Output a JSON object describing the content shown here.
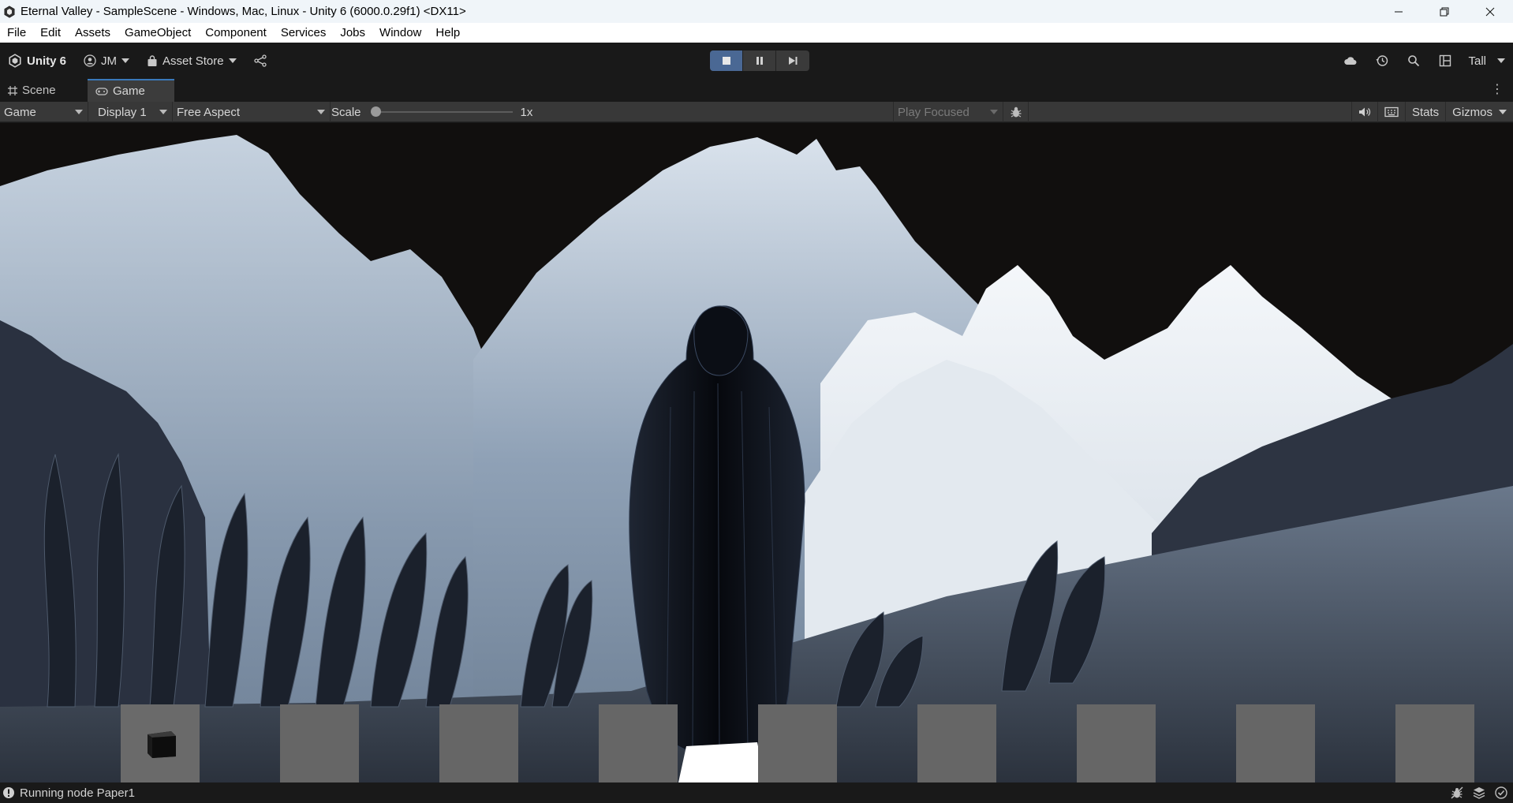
{
  "window": {
    "title": "Eternal Valley - SampleScene - Windows, Mac, Linux - Unity 6 (6000.0.29f1) <DX11>"
  },
  "menu": [
    "File",
    "Edit",
    "Assets",
    "GameObject",
    "Component",
    "Services",
    "Jobs",
    "Window",
    "Help"
  ],
  "toolbar": {
    "product": "Unity 6",
    "account": "JM",
    "asset_store": "Asset Store",
    "layout": "Tall"
  },
  "tabs": {
    "scene": "Scene",
    "game": "Game",
    "active": "Game"
  },
  "game_bar": {
    "view_mode": "Game",
    "display": "Display 1",
    "aspect": "Free Aspect",
    "scale_label": "Scale",
    "scale_value": "1x",
    "scale_fraction": 0.0,
    "play_mode": "Play Focused",
    "stats": "Stats",
    "gizmos": "Gizmos"
  },
  "hotbar": {
    "slot_count": 9,
    "slots_with_items": [
      0
    ]
  },
  "status": {
    "message": "Running node Paper1"
  },
  "colors": {
    "accent": "#3a79bb",
    "play_active": "#4a6894",
    "slot": "#666666"
  }
}
